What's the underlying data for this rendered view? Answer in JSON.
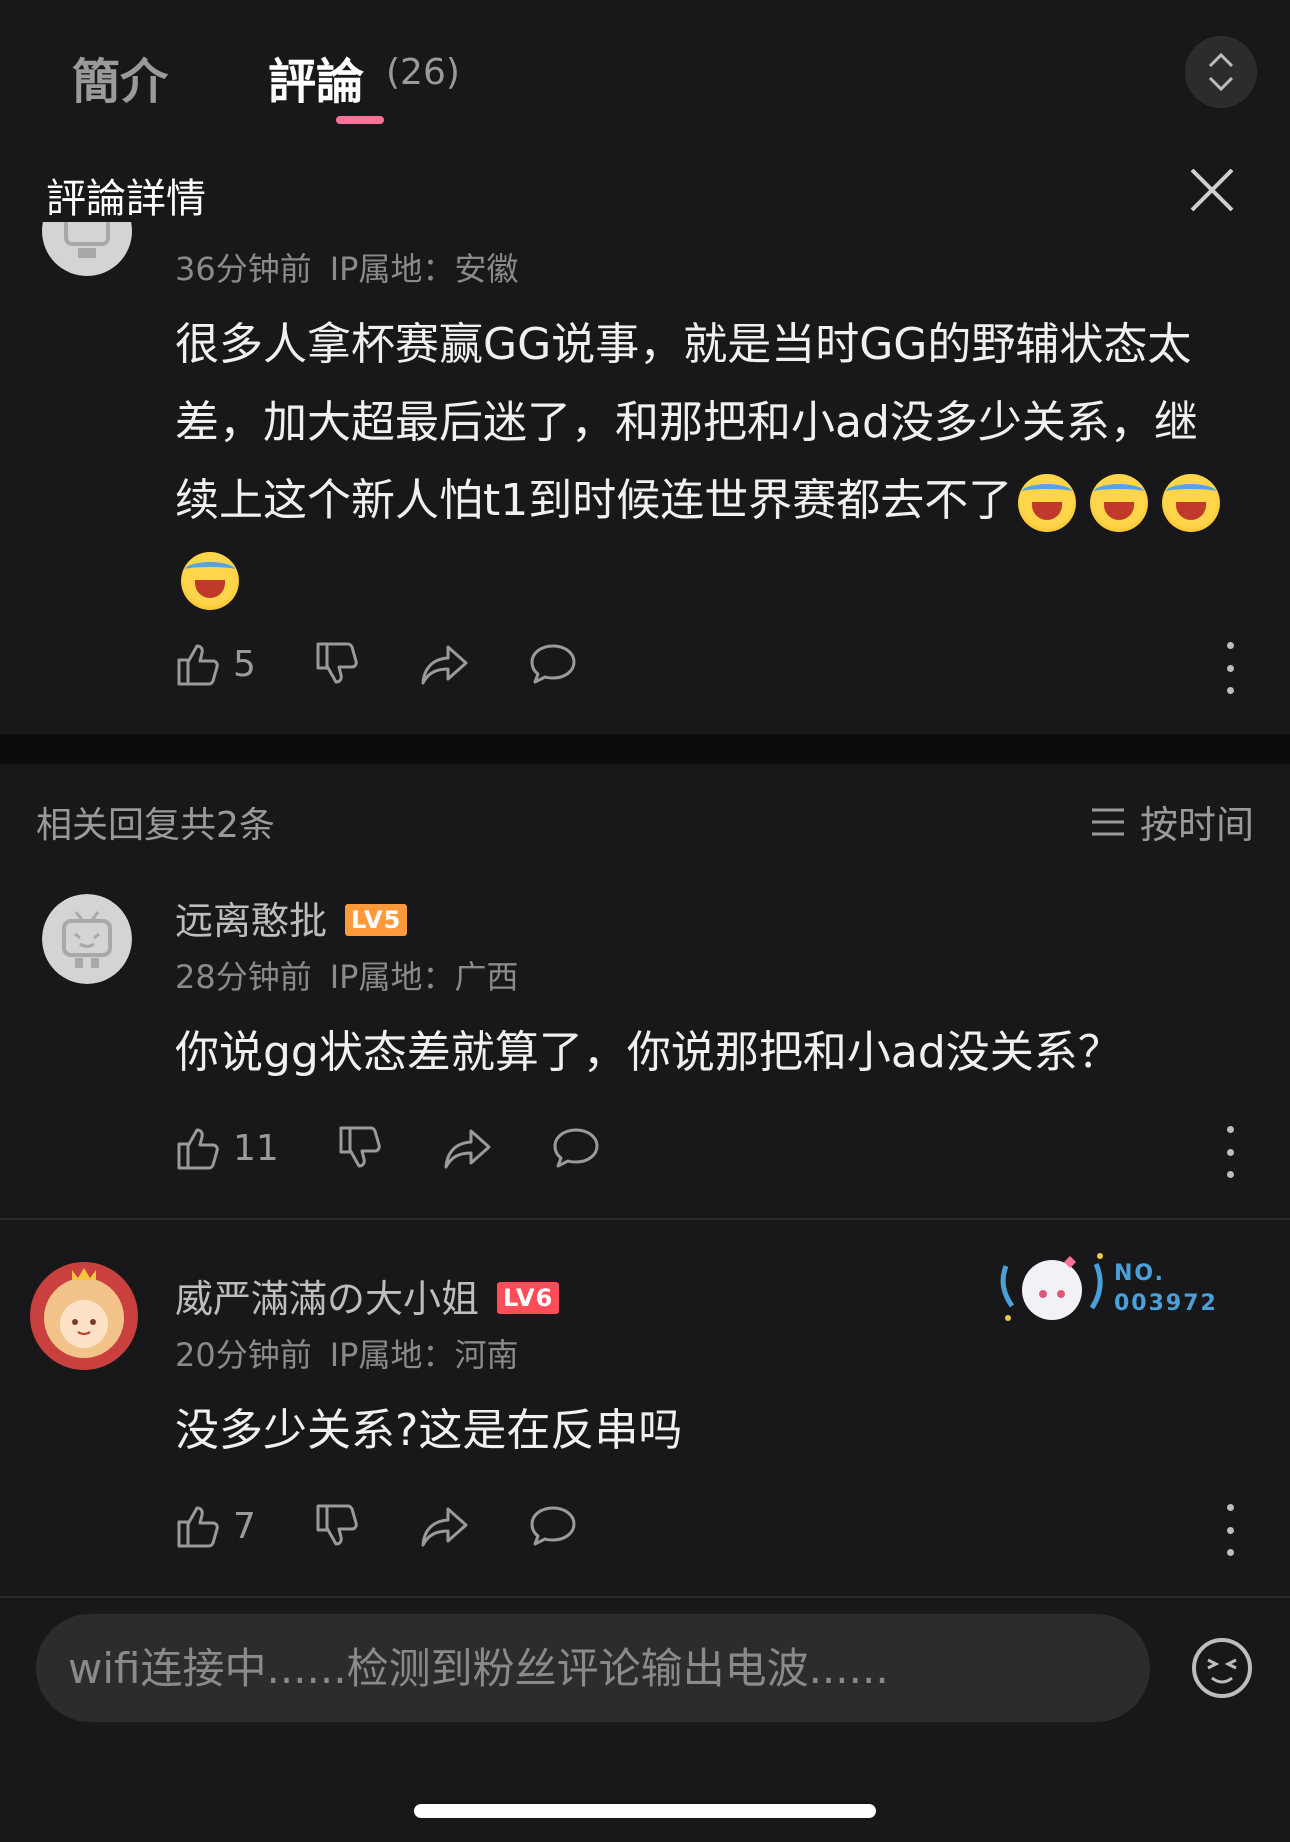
{
  "tabs": [
    {
      "label": "簡介"
    },
    {
      "label": "評論",
      "count": "(26)"
    }
  ],
  "detail_title": "評論詳情",
  "main_comment": {
    "time": "36分钟前",
    "ip": "IP属地：安徽",
    "text": "很多人拿杯赛赢GG说事，就是当时GG的野辅状态太差，加大超最后迷了，和那把和小ad没多少关系，继续上这个新人怕t1到时候连世界赛都去不了",
    "likes": "5"
  },
  "replies_header": {
    "label": "相关回复共2条",
    "sort_label": "按时间"
  },
  "replies": [
    {
      "username": "远离憨批",
      "level": "LV5",
      "level_color": "#ff9a3c",
      "time": "28分钟前",
      "ip": "IP属地：广西",
      "text": "你说gg状态差就算了，你说那把和小ad没关系？",
      "likes": "11"
    },
    {
      "username": "威严滿滿の大小姐",
      "level": "LV6",
      "level_color": "#ff4d5a",
      "time": "20分钟前",
      "ip": "IP属地：河南",
      "text": "没多少关系?这是在反串吗",
      "likes": "7",
      "fan_badge": {
        "line1": "NO.",
        "line2": "003972"
      }
    }
  ],
  "input": {
    "placeholder": "wifi连接中......检测到粉丝评论输出电波......"
  },
  "colors": {
    "accent": "#fb7299",
    "background": "#18181a"
  }
}
